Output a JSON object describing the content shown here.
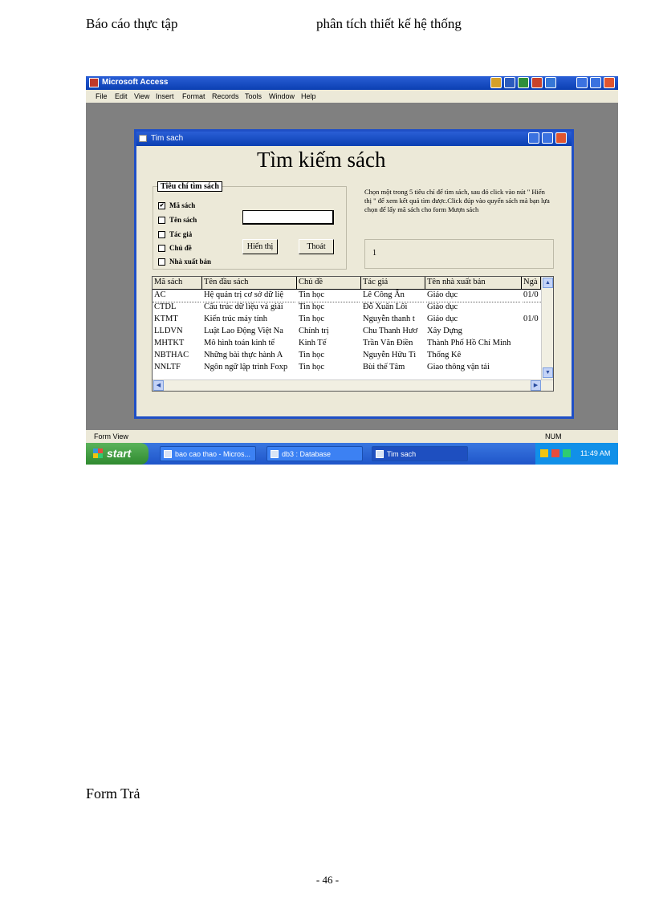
{
  "doc": {
    "header_left": "Báo cáo thực tập",
    "header_right": "phân tích thiết kế hệ thống",
    "section": "Form Trả",
    "page_number": "- 46 -"
  },
  "app": {
    "title": "Microsoft Access",
    "menu": [
      "File",
      "Edit",
      "View",
      "Insert",
      "Format",
      "Records",
      "Tools",
      "Window",
      "Help"
    ],
    "status_left": "Form View",
    "status_right": "NUM"
  },
  "taskbar": {
    "start": "start",
    "tasks": [
      "bao cao thao - Micros...",
      "db3 : Database",
      "Tim sach"
    ],
    "clock": "11:49 AM"
  },
  "form": {
    "title": "Tim sach",
    "heading": "Tìm kiếm sách",
    "group_label": "Tiêu chí tìm sách",
    "options": [
      {
        "label": "Mã sách",
        "checked": "✔"
      },
      {
        "label": "Tên sách",
        "checked": ""
      },
      {
        "label": "Tác giả",
        "checked": ""
      },
      {
        "label": "Chủ đề",
        "checked": ""
      },
      {
        "label": "Nhà xuất bản",
        "checked": ""
      }
    ],
    "show_button": "Hiển thị",
    "exit_button": "Thoát",
    "hint": "Chọn một trong 5 tiêu chí để tìm sách, sau đó click vào nút \" Hiển thị \" để xem kết quả tìm được.Click đúp vào quyển sách mà bạn lựa chọn để lấy mã sách cho form Mượn sách",
    "result_count": "1"
  },
  "grid": {
    "columns": [
      "Mã sách",
      "Tên đầu sách",
      "Chủ đề",
      "Tác giả",
      "Tên nhà xuất bản",
      "Ngà"
    ],
    "rows": [
      [
        "AC",
        "Hệ quản trị cơ sở dữ liệ",
        "Tin học",
        "Lê Công Ấn",
        "Giáo dục",
        "01/0"
      ],
      [
        "CTDL",
        "Cấu trúc dữ liệu và giải",
        "Tin học",
        "Đỗ Xuân Lôi",
        "Giáo dục",
        ""
      ],
      [
        "KTMT",
        "Kiến trúc máy tính",
        "Tin học",
        "Nguyễn thanh t",
        "Giáo dục",
        "01/0"
      ],
      [
        "LLDVN",
        "Luật Lao Động Việt Na",
        "Chính trị",
        "Chu Thanh Hươ",
        "Xây Dựng",
        ""
      ],
      [
        "MHTKT",
        "Mô hình toán kinh tế",
        "Kinh Tế",
        "Trần Văn Điền",
        "Thành Phố Hồ Chí Minh",
        ""
      ],
      [
        "NBTHAC",
        "Những bài thực hành A",
        "Tin học",
        "Nguyễn Hữu Tì",
        "Thống Kê",
        ""
      ],
      [
        "NNLTF",
        "Ngôn ngữ lập trình Foxp",
        "Tin học",
        "Bùi thế Tâm",
        "Giao thông vận tải",
        ""
      ]
    ]
  }
}
